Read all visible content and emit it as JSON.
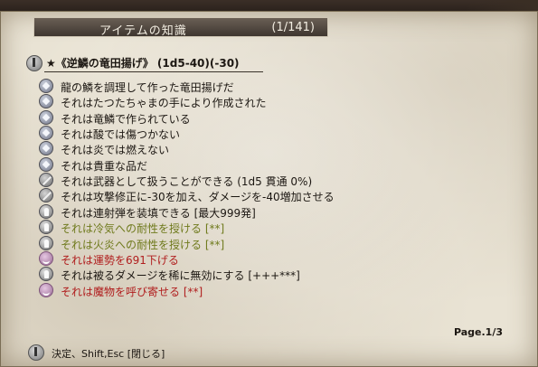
{
  "window": {
    "title": "アイテムの知識",
    "counter": "(1/141)"
  },
  "item": {
    "name": "★《逆鱗の竜田揚げ》 (1d5-40)(-30)"
  },
  "lines": [
    {
      "icon": "diamond-icon",
      "text": "龍の鱗を調理して作った竜田揚げだ",
      "color": "normal"
    },
    {
      "icon": "diamond-icon",
      "text": "それはたつたちゃまの手により作成された",
      "color": "normal"
    },
    {
      "icon": "diamond-icon",
      "text": "それは竜鱗で作られている",
      "color": "normal"
    },
    {
      "icon": "diamond-icon",
      "text": "それは酸では傷つかない",
      "color": "normal"
    },
    {
      "icon": "diamond-icon",
      "text": "それは炎では燃えない",
      "color": "normal"
    },
    {
      "icon": "diamond-icon",
      "text": "それは貴重な品だ",
      "color": "normal"
    },
    {
      "icon": "sword-icon",
      "text": "それは武器として扱うことができる (1d5 貫通 0%)",
      "color": "normal"
    },
    {
      "icon": "sword-icon",
      "text": "それは攻撃修正に-30を加え、ダメージを-40増加させる",
      "color": "normal"
    },
    {
      "icon": "bullet-icon",
      "text": "それは連射弾を装填できる [最大999発]",
      "color": "normal"
    },
    {
      "icon": "bullet-icon",
      "text": "それは冷気への耐性を授ける [**]",
      "color": "green"
    },
    {
      "icon": "bullet-icon",
      "text": "それは火炎への耐性を授ける [**]",
      "color": "green"
    },
    {
      "icon": "face-icon",
      "text": "それは運勢を691下げる",
      "color": "red"
    },
    {
      "icon": "bullet-icon",
      "text": "それは被るダメージを稀に無効にする [+++***]",
      "color": "normal"
    },
    {
      "icon": "face-icon",
      "text": "それは魔物を呼び寄せる [**]",
      "color": "red"
    }
  ],
  "page_indicator": "Page.1/3",
  "footer": {
    "hint": "決定、Shift,Esc [閉じる]"
  },
  "colors": {
    "parchment": "#e9e3d4",
    "title_bar": "#4f463e",
    "text": "#1c1712",
    "green_text": "#6f7a1c",
    "red_text": "#b01d1d"
  }
}
